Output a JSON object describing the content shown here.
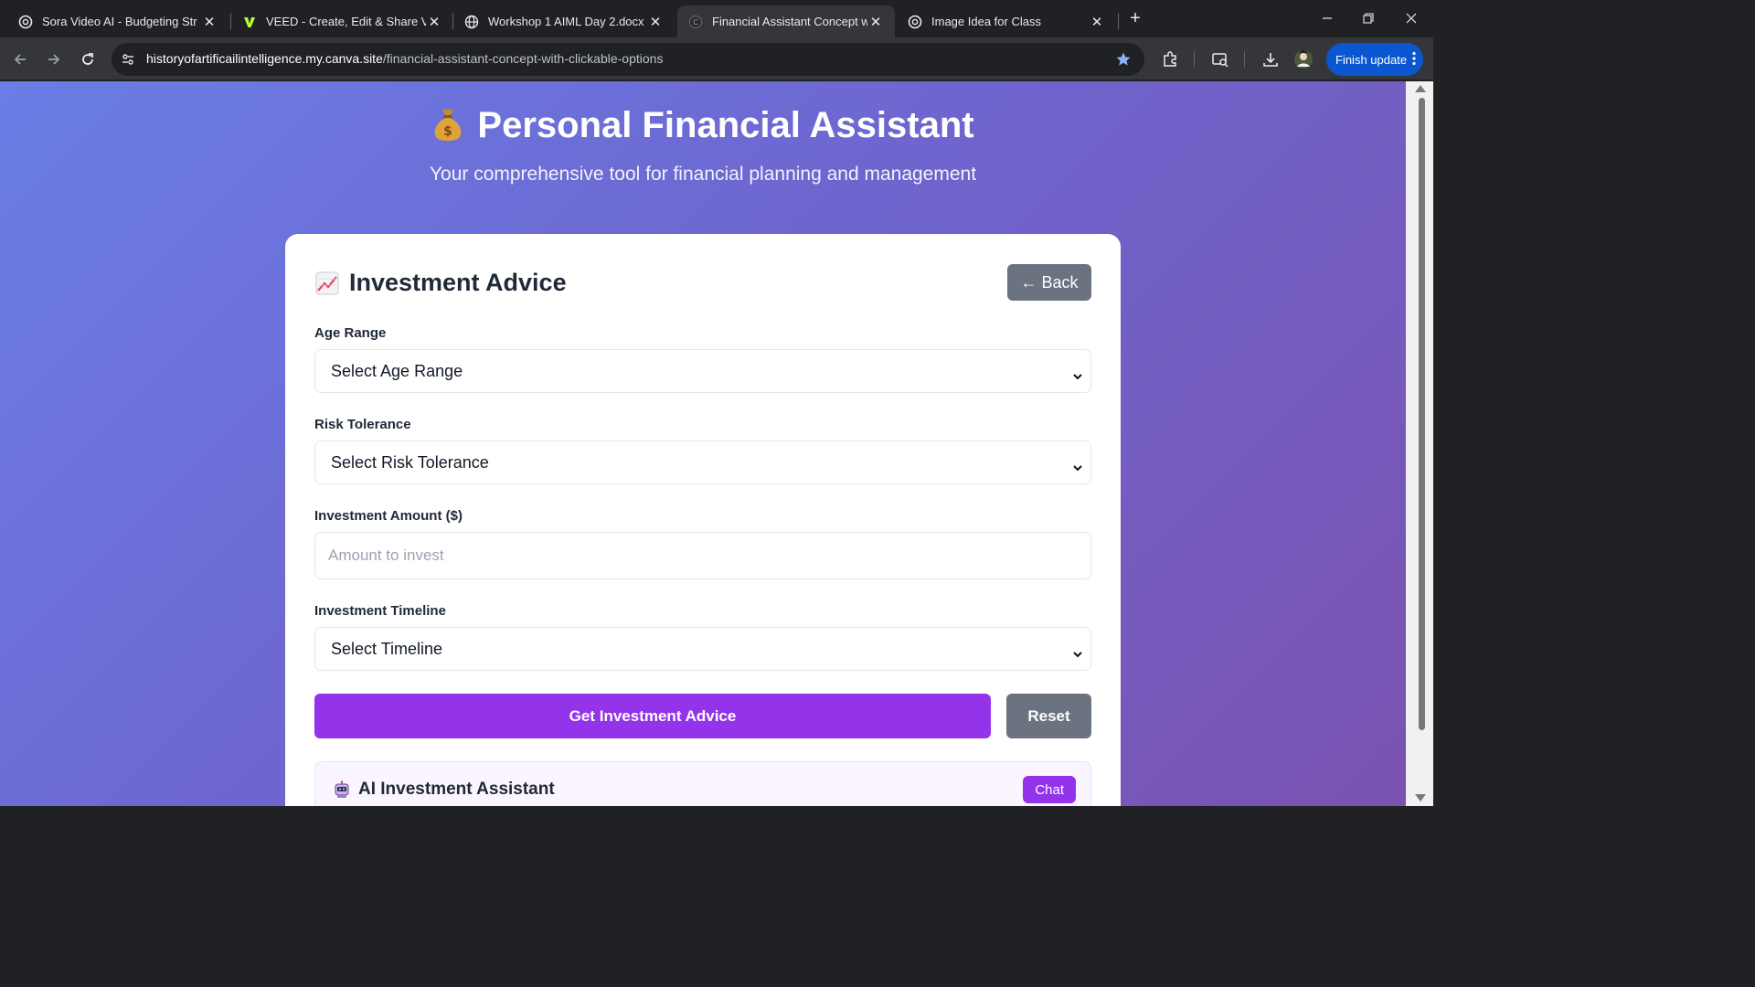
{
  "browser": {
    "tabs": [
      {
        "title": "Sora Video AI - Budgeting Str",
        "icon": "openai-icon",
        "active": false
      },
      {
        "title": "VEED - Create, Edit & Share Vid",
        "icon": "veed-icon",
        "active": false
      },
      {
        "title": "Workshop 1 AIML Day 2.docx",
        "icon": "globe-icon",
        "active": false
      },
      {
        "title": "Financial Assistant Concept witl",
        "icon": "canva-icon",
        "active": true
      },
      {
        "title": "Image Idea for Class",
        "icon": "openai-icon",
        "active": false
      }
    ],
    "url_host": "historyofartificailintelligence.my.canva.site",
    "url_path": "/financial-assistant-concept-with-clickable-options",
    "finish_update_label": "Finish update"
  },
  "header": {
    "emoji": "💰",
    "title": "Personal Financial Assistant",
    "subtitle": "Your comprehensive tool for financial planning and management"
  },
  "card": {
    "emoji": "📈",
    "title": "Investment Advice",
    "back_label": "← Back",
    "fields": {
      "age": {
        "label": "Age Range",
        "value": "Select Age Range"
      },
      "risk": {
        "label": "Risk Tolerance",
        "value": "Select Risk Tolerance"
      },
      "amount": {
        "label": "Investment Amount ($)",
        "placeholder": "Amount to invest"
      },
      "timeline": {
        "label": "Investment Timeline",
        "value": "Select Timeline"
      }
    },
    "submit_label": "Get Investment Advice",
    "reset_label": "Reset"
  },
  "assistant": {
    "emoji": "🤖",
    "title": "AI Investment Assistant",
    "badge": "Chat"
  },
  "colors": {
    "accent_purple": "#9333ea",
    "gray_button": "#6b7280",
    "gradient_start": "#6a7ee6",
    "gradient_end": "#7a52b0",
    "chrome_blue": "#0b57d0"
  }
}
